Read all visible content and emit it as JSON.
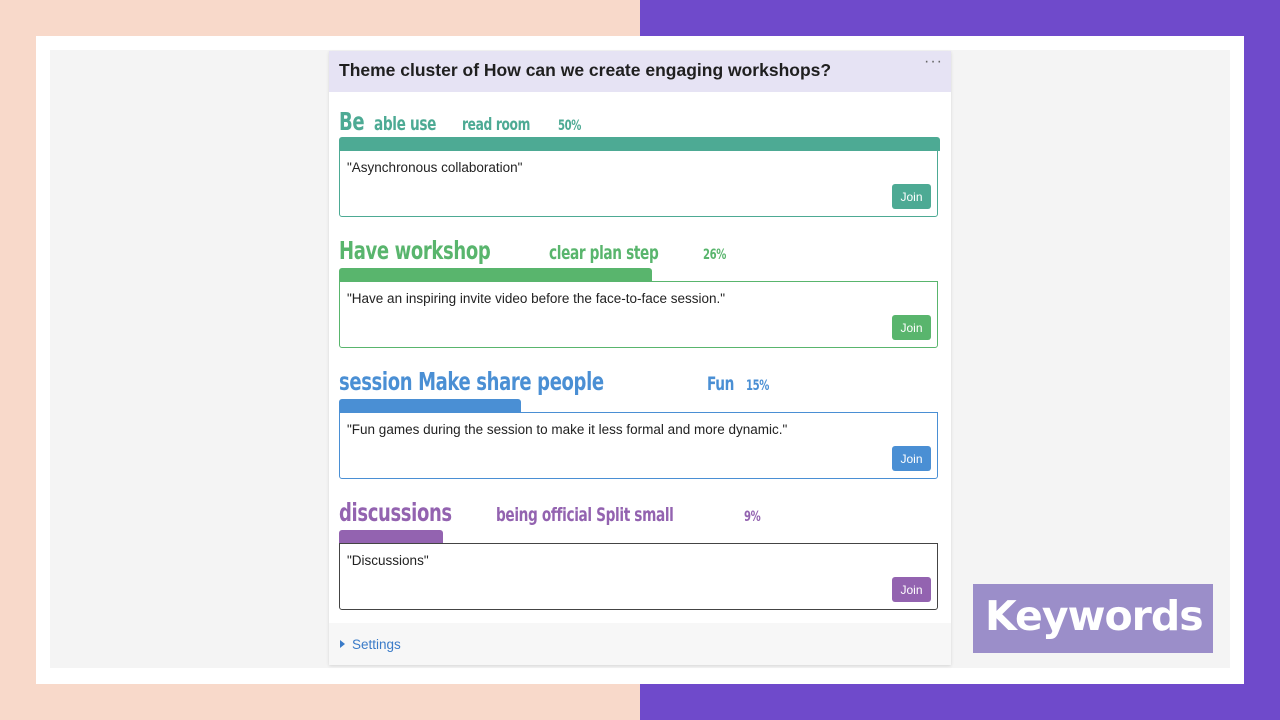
{
  "widget": {
    "title": "Theme cluster of How can we create engaging workshops?",
    "more_icon": "more-horizontal-icon",
    "more_glyph": "···"
  },
  "themes": [
    {
      "color": "#4daa94",
      "words": [
        "Be",
        "able use",
        "read room",
        "50%"
      ],
      "percent": 50,
      "quote": "\"Asynchronous collaboration\"",
      "join_label": "Join"
    },
    {
      "color": "#59b56d",
      "words": [
        "Have workshop",
        "clear plan step",
        "26%"
      ],
      "percent": 26,
      "quote": "\"Have an inspiring invite video before the face-to-face session.\"",
      "join_label": "Join"
    },
    {
      "color": "#4a8fd4",
      "words": [
        "session Make share people",
        "Fun",
        "15%"
      ],
      "percent": 15,
      "quote": "\"Fun games during the session to make it less formal and more dynamic.\"",
      "join_label": "Join"
    },
    {
      "color": "#9363b0",
      "words": [
        "discussions",
        "being official Split small",
        "9%"
      ],
      "percent": 9,
      "quote": "\"Discussions\"",
      "join_label": "Join"
    }
  ],
  "settings": {
    "label": "Settings",
    "icon": "caret-right-icon"
  },
  "overlay": {
    "label": "Keywords",
    "color": "#9b8ec9"
  }
}
